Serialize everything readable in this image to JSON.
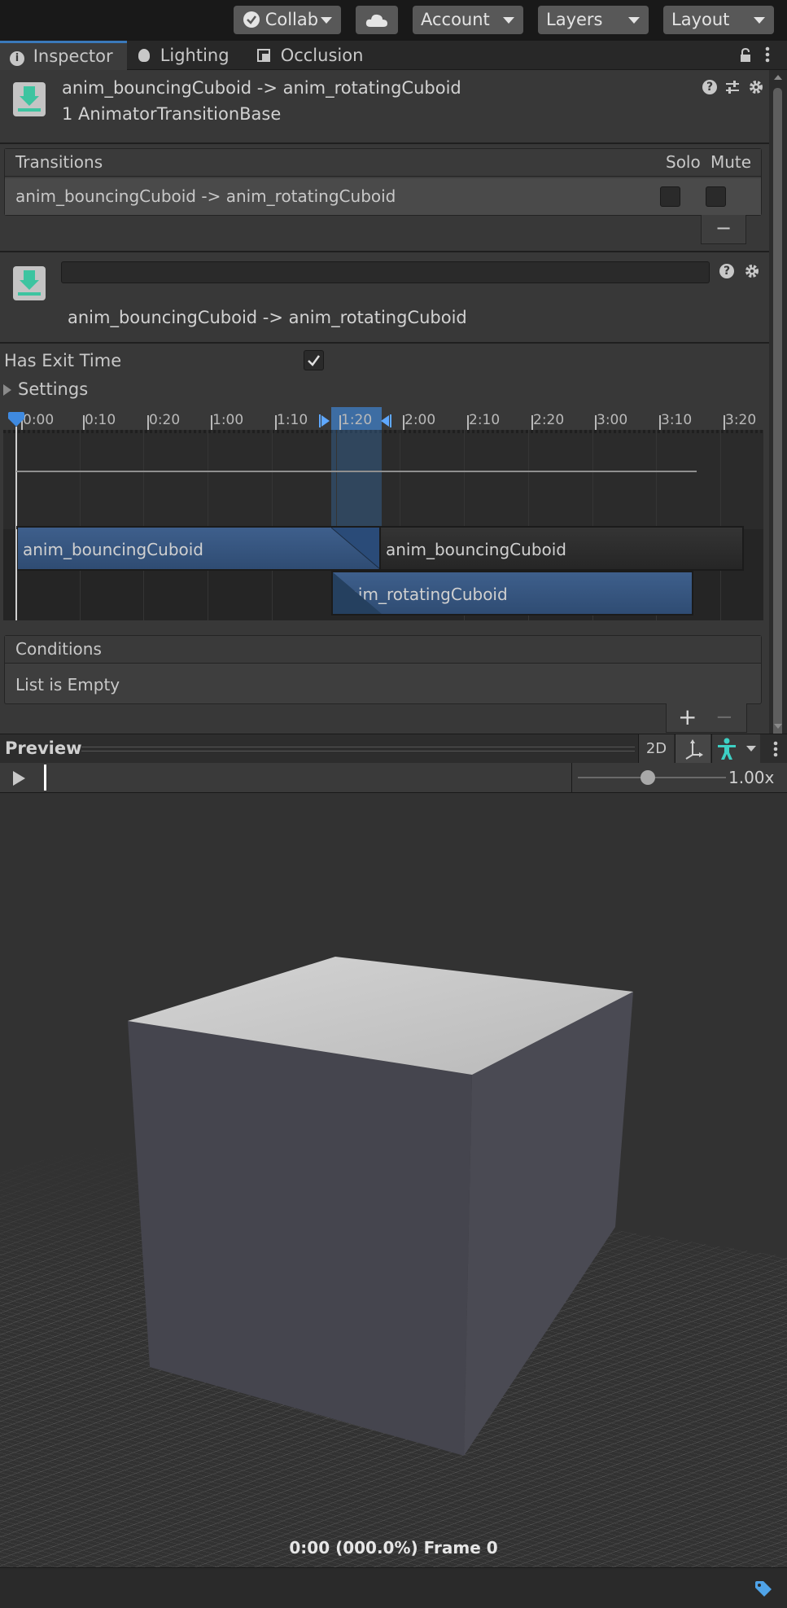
{
  "toolbar": {
    "collab_label": "Collab",
    "account_label": "Account",
    "layers_label": "Layers",
    "layout_label": "Layout"
  },
  "tabs": [
    {
      "label": "Inspector",
      "icon": "info-icon",
      "active": true
    },
    {
      "label": "Lighting",
      "icon": "lightbulb-icon",
      "active": false
    },
    {
      "label": "Occlusion",
      "icon": "occlusion-icon",
      "active": false
    }
  ],
  "header": {
    "title": "anim_bouncingCuboid -> anim_rotatingCuboid",
    "subtitle": "1 AnimatorTransitionBase"
  },
  "transitions": {
    "heading": "Transitions",
    "solo_label": "Solo",
    "mute_label": "Mute",
    "rows": [
      {
        "name": "anim_bouncingCuboid -> anim_rotatingCuboid",
        "solo": false,
        "mute": false
      }
    ],
    "remove_label": "−"
  },
  "transition_detail": {
    "name_field_value": "",
    "name": "anim_bouncingCuboid -> anim_rotatingCuboid",
    "has_exit_time_label": "Has Exit Time",
    "has_exit_time": true,
    "settings_label": "Settings"
  },
  "timeline": {
    "ticks": [
      "0:00",
      "0:10",
      "0:20",
      "1:00",
      "1:10",
      "1:20",
      "2:00",
      "2:10",
      "2:20",
      "3:00",
      "3:10",
      "3:20"
    ],
    "clips": {
      "source_label": "anim_bouncingCuboid",
      "source_after_label": "anim_bouncingCuboid",
      "destination_label": "anim_rotatingCuboid"
    }
  },
  "conditions": {
    "heading": "Conditions",
    "empty_label": "List is Empty",
    "add_label": "+",
    "remove_label": "−"
  },
  "preview": {
    "title": "Preview",
    "mode_2d_label": "2D",
    "speed_label": "1.00x",
    "speed_slider_fraction": 0.47,
    "frame_info": "0:00 (000.0%) Frame 0"
  },
  "colors": {
    "accent_blue": "#3a79bb",
    "teal": "#3dc4a0"
  }
}
